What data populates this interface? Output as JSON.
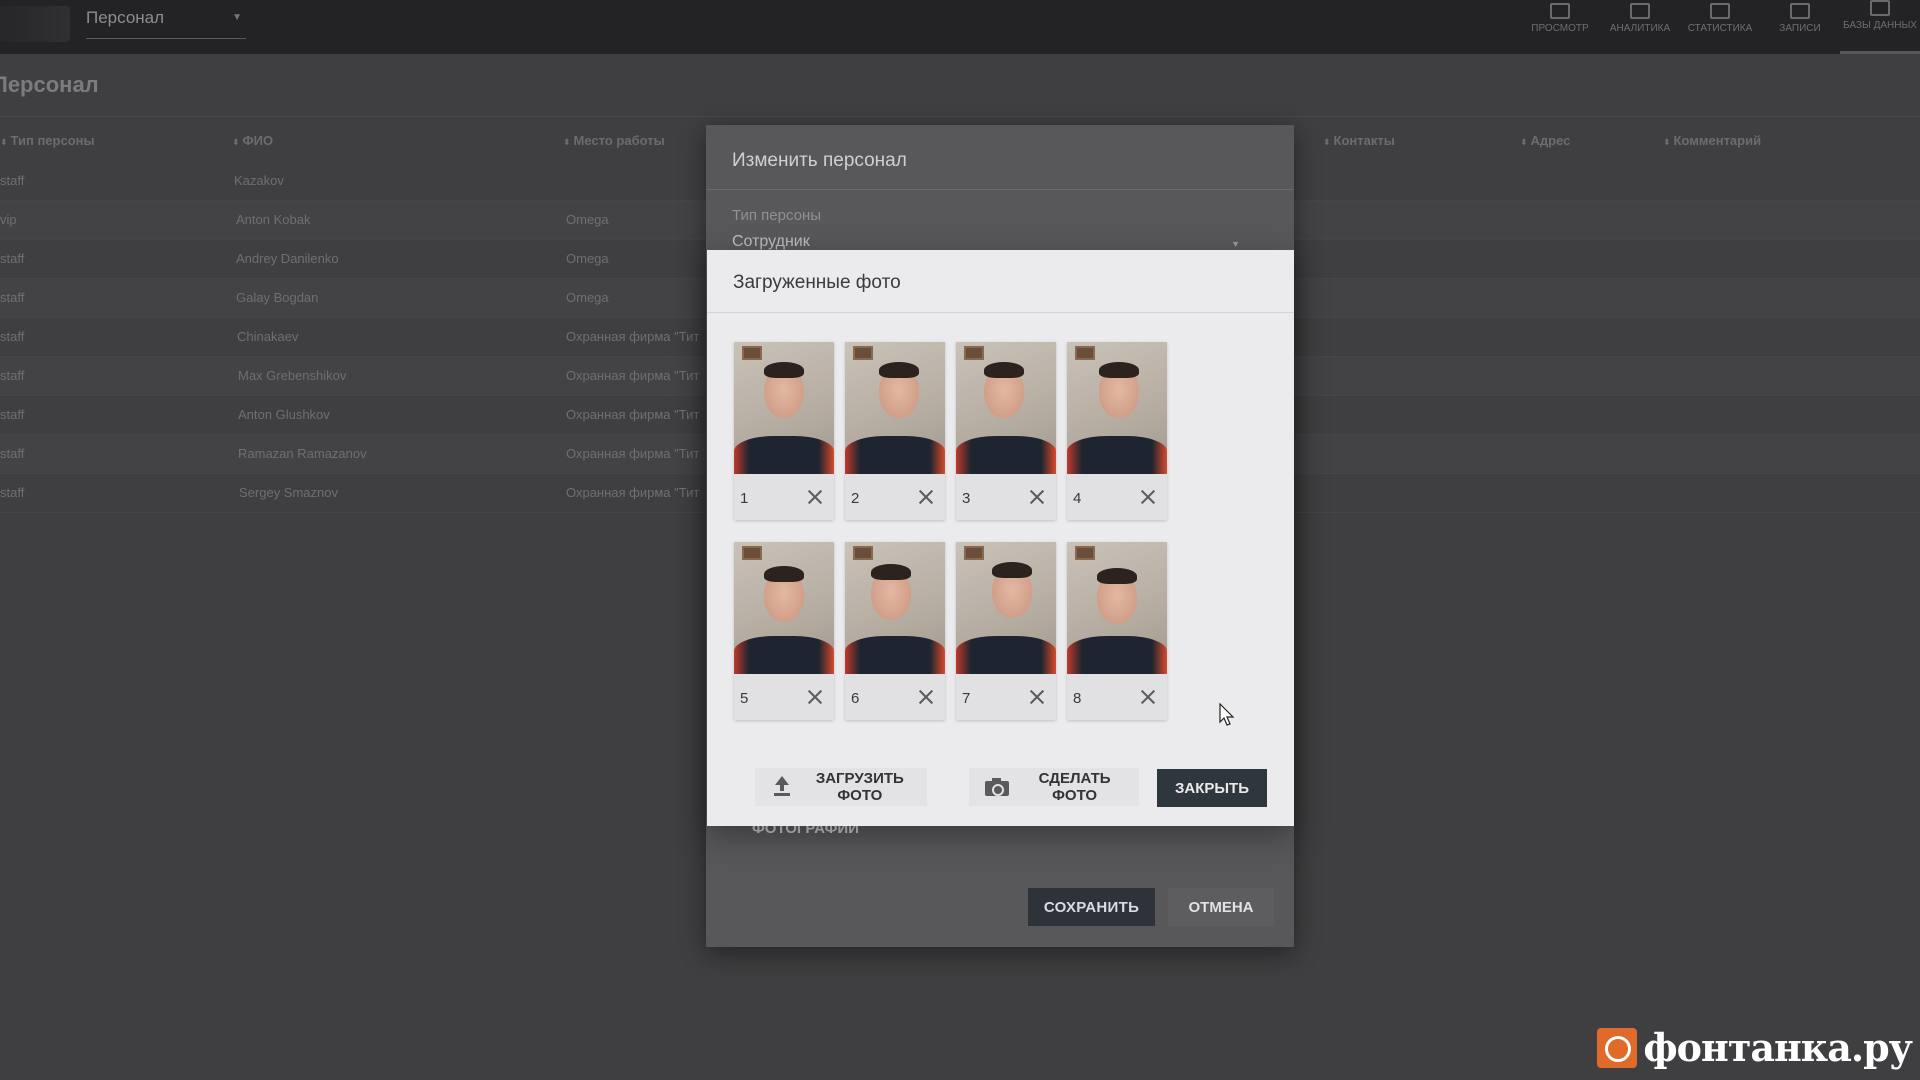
{
  "app": {
    "section_select": "Персонал",
    "nav": [
      {
        "label": "ПРОСМОТР"
      },
      {
        "label": "АНАЛИТИКА"
      },
      {
        "label": "СТАТИСТИКА"
      },
      {
        "label": "ЗАПИСИ"
      },
      {
        "label": "БАЗЫ ДАННЫХ"
      }
    ],
    "page_title": "Персонал",
    "columns": [
      "Тип персоны",
      "ФИО",
      "Место работы",
      "Контакты",
      "Адрес",
      "Комментарий"
    ],
    "rows": [
      {
        "type": "staff",
        "name": "Kazakov",
        "work": ""
      },
      {
        "type": "vip",
        "name": "Anton Kobak",
        "work": "Omega"
      },
      {
        "type": "staff",
        "name": "Andrey Danilenko",
        "work": "Omega"
      },
      {
        "type": "staff",
        "name": "Galay Bogdan",
        "work": "Omega"
      },
      {
        "type": "staff",
        "name": "Chinakaev",
        "work": "Охранная фирма \"Тит"
      },
      {
        "type": "staff",
        "name": "Max Grebenshikov",
        "work": "Охранная фирма \"Тит"
      },
      {
        "type": "staff",
        "name": "Anton Glushkov",
        "work": "Охранная фирма \"Тит"
      },
      {
        "type": "staff",
        "name": "Ramazan Ramazanov",
        "work": "Охранная фирма \"Тит"
      },
      {
        "type": "staff",
        "name": "Sergey Smaznov",
        "work": "Охранная фирма \"Тит"
      }
    ]
  },
  "edit_modal": {
    "title": "Изменить персонал",
    "person_type_label": "Тип персоны",
    "person_type_value": "Сотрудник",
    "photos_label": "ФОТОГРАФИИ",
    "save_label": "СОХРАНИТЬ",
    "cancel_label": "ОТМЕНА"
  },
  "photos_dialog": {
    "title": "Загруженные фото",
    "photos": [
      {
        "number": "1"
      },
      {
        "number": "2"
      },
      {
        "number": "3"
      },
      {
        "number": "4"
      },
      {
        "number": "5"
      },
      {
        "number": "6"
      },
      {
        "number": "7"
      },
      {
        "number": "8"
      }
    ],
    "upload_label": "ЗАГРУЗИТЬ ФОТО",
    "take_label": "СДЕЛАТЬ ФОТО",
    "close_label": "ЗАКРЫТЬ",
    "icons": [
      "upload-icon",
      "camera-icon",
      "close-icon"
    ]
  },
  "watermark": {
    "text": "фонтанка.ру"
  },
  "colors": {
    "primary_button": "#2e373e",
    "dialog_bg": "#ebebed",
    "overlay_bg": "#3f3f41",
    "watermark_accent": "#e06a2a"
  }
}
